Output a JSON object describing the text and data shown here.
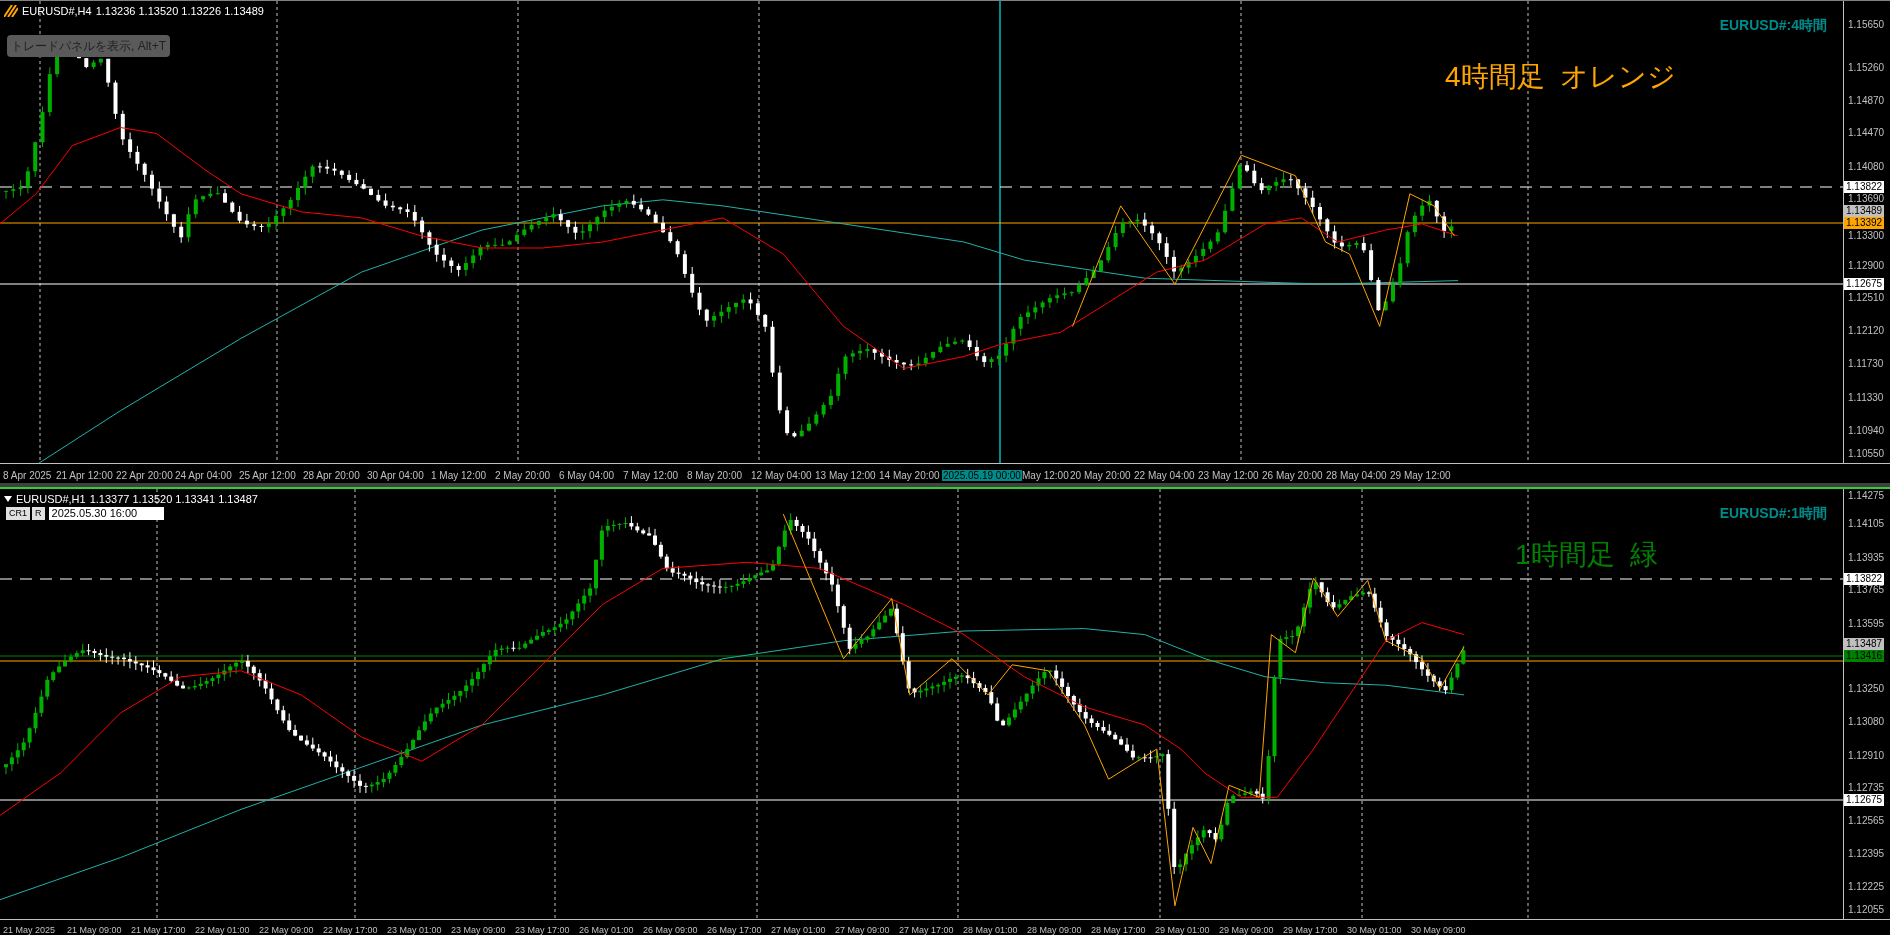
{
  "charts": [
    {
      "header": {
        "symbol": "EURUSD#,H4",
        "prices": "1.13236 1.13520 1.13226 1.13489"
      },
      "tooltip": "トレードパネルを表示, Alt+T",
      "symbol_label": "EURUSD#:4時間",
      "annotation": {
        "text": "4時間足  オレンジ",
        "color": "#ffa500"
      },
      "price_axis": [
        "1.15650",
        "1.15260",
        "1.14870",
        "1.14470",
        "1.14080",
        "1.13690",
        "1.13300",
        "1.12900",
        "1.12510",
        "1.12120",
        "1.11730",
        "1.11330",
        "1.10940",
        "1.10550"
      ],
      "price_tags": [
        {
          "text": "1.13822",
          "kind": "dashed_line",
          "color": "#ffffff"
        },
        {
          "text": "1.13489",
          "kind": "bid",
          "color": "#c0c0c0"
        },
        {
          "text": "1.13392",
          "kind": "solid_line",
          "color": "#ffa500"
        },
        {
          "text": "1.12675",
          "kind": "solid_line",
          "color": "#ffffff"
        }
      ],
      "time_axis": [
        {
          "text": "8 Apr 2025",
          "highlighted": false
        },
        {
          "text": "21 Apr 12:00",
          "highlighted": false
        },
        {
          "text": "22 Apr 20:00",
          "highlighted": false
        },
        {
          "text": "24 Apr 04:00",
          "highlighted": false
        },
        {
          "text": "25 Apr 12:00",
          "highlighted": false
        },
        {
          "text": "28 Apr 20:00",
          "highlighted": false
        },
        {
          "text": "30 Apr 04:00",
          "highlighted": false
        },
        {
          "text": "1 May 12:00",
          "highlighted": false
        },
        {
          "text": "2 May 20:00",
          "highlighted": false
        },
        {
          "text": "6 May 04:00",
          "highlighted": false
        },
        {
          "text": "7 May 12:00",
          "highlighted": false
        },
        {
          "text": "8 May 20:00",
          "highlighted": false
        },
        {
          "text": "12 May 04:00",
          "highlighted": false
        },
        {
          "text": "13 May 12:00",
          "highlighted": false
        },
        {
          "text": "14 May 20:00",
          "highlighted": false
        },
        {
          "text": "2025.05.19 00:00",
          "highlighted": true
        },
        {
          "text": "May 12:00",
          "highlighted": false
        },
        {
          "text": "20 May 20:00",
          "highlighted": false
        },
        {
          "text": "22 May 04:00",
          "highlighted": false
        },
        {
          "text": "23 May 12:00",
          "highlighted": false
        },
        {
          "text": "26 May 20:00",
          "highlighted": false
        },
        {
          "text": "28 May 04:00",
          "highlighted": false
        },
        {
          "text": "29 May 12:00",
          "highlighted": false
        }
      ]
    },
    {
      "header": {
        "symbol": "EURUSD#,H1",
        "prices": "1.13377 1.13520 1.13341 1.13487"
      },
      "buttons": [
        "CR1",
        "R"
      ],
      "datetime_field": {
        "value": "2025.05.30 16:00"
      },
      "symbol_label": "EURUSD#:1時間",
      "annotation": {
        "text": "1時間足  緑",
        "color": "#008000"
      },
      "price_axis": [
        "1.14275",
        "1.14105",
        "1.13935",
        "1.13765",
        "1.13595",
        "1.13250",
        "1.13080",
        "1.12910",
        "1.12735",
        "1.12565",
        "1.12395",
        "1.12225",
        "1.12055"
      ],
      "price_tags": [
        {
          "text": "1.13822",
          "kind": "dashed_line",
          "color": "#ffffff"
        },
        {
          "text": "1.13487",
          "kind": "bid",
          "color": "#c0c0c0"
        },
        {
          "text": "1.13416",
          "kind": "solid_line",
          "color": "#008000"
        },
        {
          "text": "1.12675",
          "kind": "solid_line",
          "color": "#ffffff"
        }
      ],
      "time_axis": [
        {
          "text": "21 May 2025",
          "highlighted": false
        },
        {
          "text": "21 May 09:00",
          "highlighted": false
        },
        {
          "text": "21 May 17:00",
          "highlighted": false
        },
        {
          "text": "22 May 01:00",
          "highlighted": false
        },
        {
          "text": "22 May 09:00",
          "highlighted": false
        },
        {
          "text": "22 May 17:00",
          "highlighted": false
        },
        {
          "text": "23 May 01:00",
          "highlighted": false
        },
        {
          "text": "23 May 09:00",
          "highlighted": false
        },
        {
          "text": "23 May 17:00",
          "highlighted": false
        },
        {
          "text": "26 May 01:00",
          "highlighted": false
        },
        {
          "text": "26 May 09:00",
          "highlighted": false
        },
        {
          "text": "26 May 17:00",
          "highlighted": false
        },
        {
          "text": "27 May 01:00",
          "highlighted": false
        },
        {
          "text": "27 May 09:00",
          "highlighted": false
        },
        {
          "text": "27 May 17:00",
          "highlighted": false
        },
        {
          "text": "28 May 01:00",
          "highlighted": false
        },
        {
          "text": "28 May 09:00",
          "highlighted": false
        },
        {
          "text": "28 May 17:00",
          "highlighted": false
        },
        {
          "text": "29 May 01:00",
          "highlighted": false
        },
        {
          "text": "29 May 09:00",
          "highlighted": false
        },
        {
          "text": "29 May 17:00",
          "highlighted": false
        },
        {
          "text": "30 May 01:00",
          "highlighted": false
        },
        {
          "text": "30 May 09:00",
          "highlighted": false
        }
      ]
    }
  ]
}
